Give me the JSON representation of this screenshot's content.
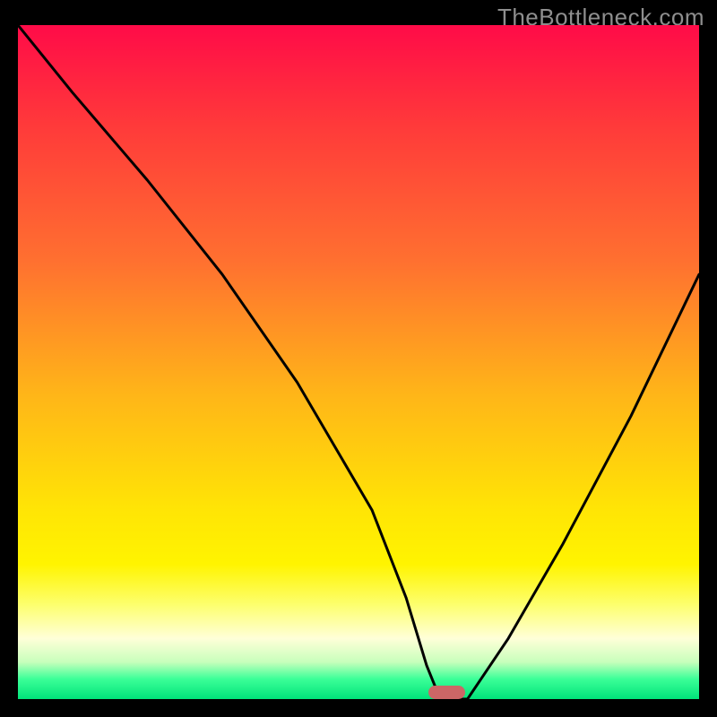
{
  "watermark": "TheBottleneck.com",
  "colors": {
    "frame": "#000000",
    "watermark": "#8e8e8e",
    "curve": "#000000",
    "marker": "#cc6666",
    "gradient_stops": [
      {
        "offset": 0.0,
        "color": "#ff0b48"
      },
      {
        "offset": 0.15,
        "color": "#ff3a3a"
      },
      {
        "offset": 0.35,
        "color": "#ff7030"
      },
      {
        "offset": 0.55,
        "color": "#ffb618"
      },
      {
        "offset": 0.72,
        "color": "#ffe505"
      },
      {
        "offset": 0.8,
        "color": "#fff400"
      },
      {
        "offset": 0.86,
        "color": "#fdff6e"
      },
      {
        "offset": 0.91,
        "color": "#ffffd8"
      },
      {
        "offset": 0.945,
        "color": "#c8ffbc"
      },
      {
        "offset": 0.97,
        "color": "#3cff98"
      },
      {
        "offset": 1.0,
        "color": "#00e37a"
      }
    ]
  },
  "chart_data": {
    "type": "line",
    "title": "",
    "xlabel": "",
    "ylabel": "",
    "xrange": [
      0,
      100
    ],
    "yrange": [
      0,
      100
    ],
    "series": [
      {
        "name": "bottleneck-curve",
        "x": [
          0,
          8,
          19,
          30,
          41,
          52,
          57,
          60,
          62,
          64,
          66,
          72,
          80,
          90,
          100
        ],
        "y": [
          100,
          90,
          77,
          63,
          47,
          28,
          15,
          5,
          0,
          0,
          0,
          9,
          23,
          42,
          63
        ]
      }
    ],
    "marker": {
      "x_center": 63,
      "y": 0,
      "width_pct": 5.4,
      "height_pct": 2.0
    }
  }
}
